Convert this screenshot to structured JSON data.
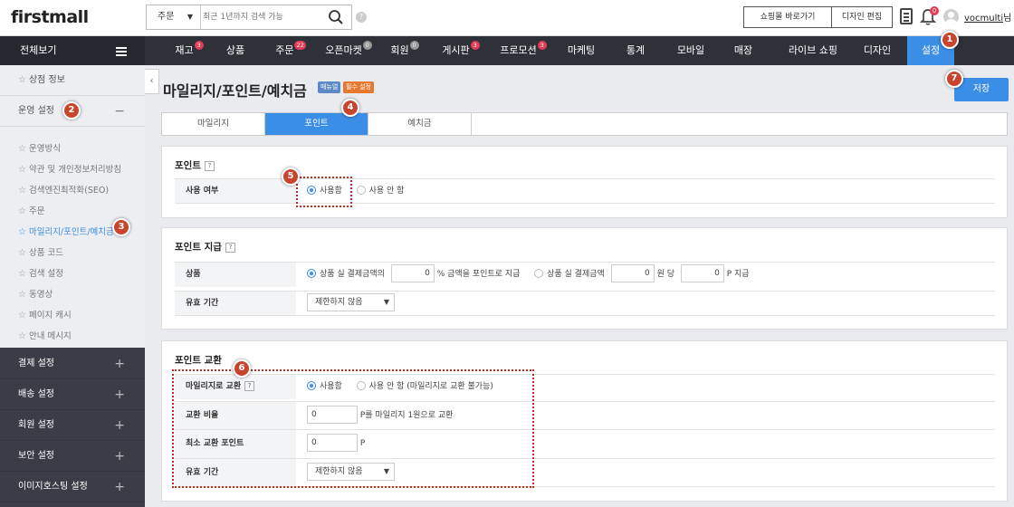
{
  "header": {
    "logo": "firstmall",
    "search_category": "주문",
    "search_placeholder": "최근 1년까지 검색 가능",
    "help": "?",
    "btn_shop": "쇼핑몰 바로가기",
    "btn_design": "디자인 편집",
    "bell_count": "0",
    "username": "vocmulti",
    "username_suffix": "님"
  },
  "topnav": {
    "allview": "전체보기",
    "items": [
      {
        "label": "재고",
        "badge": "3"
      },
      {
        "label": "상품",
        "badge": ""
      },
      {
        "label": "주문",
        "badge": "22"
      },
      {
        "label": "오픈마켓",
        "badge": "0"
      },
      {
        "label": "회원",
        "badge": "0"
      },
      {
        "label": "게시판",
        "badge": "3"
      },
      {
        "label": "프로모션",
        "badge": "3"
      },
      {
        "label": "마케팅",
        "badge": ""
      },
      {
        "label": "통계",
        "badge": ""
      },
      {
        "label": "모바일",
        "badge": ""
      },
      {
        "label": "매장",
        "badge": ""
      },
      {
        "label": "라이브 쇼핑",
        "badge": ""
      },
      {
        "label": "디자인",
        "badge": ""
      },
      {
        "label": "설정",
        "badge": ""
      }
    ]
  },
  "sidebar": {
    "shop_info": "상점 정보",
    "ops_settings": "운영 설정",
    "minus": "−",
    "sub_items": [
      "운영방식",
      "약관 및 개인정보처리방침",
      "검색엔진최적화(SEO)",
      "주문",
      "마일리지/포인트/예치금",
      "상품 코드",
      "검색 설정",
      "동영상",
      "페이지 캐시",
      "안내 메시지"
    ],
    "groups": [
      "결제 설정",
      "배송 설정",
      "회원 설정",
      "보안 설정",
      "이미지호스팅 설정"
    ],
    "plus": "+"
  },
  "page": {
    "title": "마일리지/포인트/예치금",
    "tag_manual": "매뉴얼",
    "tag_required": "필수 설정",
    "save": "저장",
    "tabs": [
      "마일리지",
      "포인트",
      "예치금"
    ]
  },
  "section_point": {
    "title": "포인트",
    "row_label": "사용 여부",
    "opt_use": "사용함",
    "opt_nouse": "사용 안 함"
  },
  "section_grant": {
    "title": "포인트 지급",
    "row1_label": "상품",
    "opt1_pre": "상품 실 결제금액의",
    "opt1_value": "0",
    "opt1_post": "% 금액을 포인트로 지급",
    "opt2_pre": "상품 실 결제금액",
    "opt2_value1": "0",
    "opt2_mid": "원 당",
    "opt2_value2": "0",
    "opt2_post": "P 지급",
    "row2_label": "유효 기간",
    "validity": "제한하지 않음"
  },
  "section_exchange": {
    "title": "포인트 교환",
    "row1_label": "마일리지로 교환",
    "opt_use": "사용함",
    "opt_nouse": "사용 안 함 (마일리지로 교환 불가능)",
    "row2_label": "교환 비율",
    "ratio_value": "0",
    "ratio_text": "P를 마일리지 1원으로 교환",
    "row3_label": "최소 교환 포인트",
    "min_value": "0",
    "min_unit": "P",
    "row4_label": "유효 기간",
    "validity": "제한하지 않음"
  },
  "callouts": [
    "1",
    "2",
    "3",
    "4",
    "5",
    "6",
    "7"
  ],
  "colors": {
    "accent": "#3a8ee6",
    "badge": "#e63b54",
    "callout": "#c8442d",
    "nav_bg": "#2f3139",
    "sidebar_bg": "#3b3d46"
  }
}
